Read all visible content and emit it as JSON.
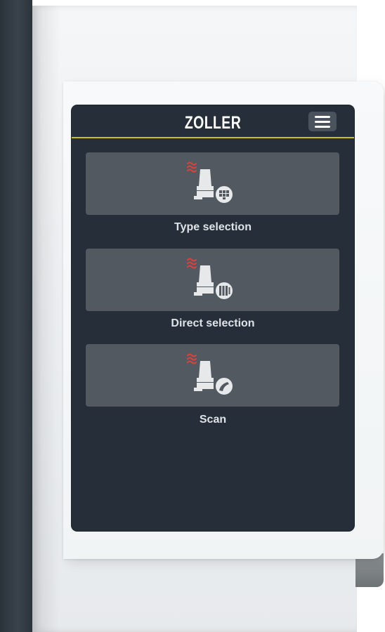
{
  "header": {
    "brand": "ZOLLER",
    "menu_icon": "hamburger-menu-icon"
  },
  "colors": {
    "display_bg": "#262f39",
    "tile_bg": "#525961",
    "header_accent": "#c9c119",
    "heat_icon": "#e0413a"
  },
  "tiles": [
    {
      "label": "Type selection",
      "icon": "tool-holder-type-grid-icon"
    },
    {
      "label": "Direct selection",
      "icon": "tool-holder-direct-selection-icon"
    },
    {
      "label": "Scan",
      "icon": "tool-holder-scan-icon"
    }
  ]
}
